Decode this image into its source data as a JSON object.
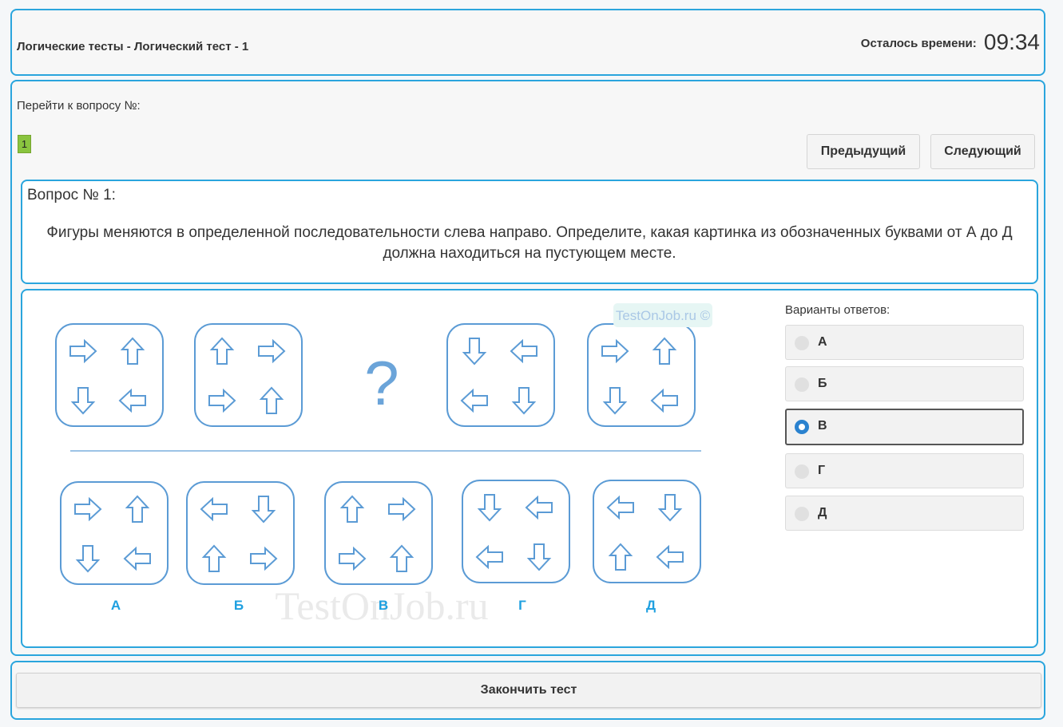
{
  "header": {
    "title": "Логические тесты - Логический тест - 1",
    "timer_label": "Осталось времени:",
    "timer_value": "09:34"
  },
  "navigation": {
    "goto_label": "Перейти к вопросу №:",
    "question_numbers": [
      "1"
    ],
    "prev_label": "Предыдущий",
    "next_label": "Следующий"
  },
  "question": {
    "heading": "Вопрос № 1:",
    "text": "Фигуры меняются в определенной последовательности слева направо. Определите, какая картинка из обозначенных буквами от А до Д должна находиться на пустующем месте."
  },
  "puzzle": {
    "question_mark": "?",
    "watermark_small": "TestOnJob.ru ©",
    "watermark_large": "TestOnJob.ru",
    "option_letters": [
      "А",
      "Б",
      "В",
      "Г",
      "Д"
    ],
    "top_sequence": [
      [
        "right",
        "up",
        "down",
        "left"
      ],
      [
        "up",
        "right",
        "right",
        "up"
      ],
      null,
      [
        "down",
        "left",
        "left",
        "down"
      ],
      [
        "right",
        "up",
        "down",
        "left"
      ]
    ],
    "choices": [
      [
        "right",
        "up",
        "down",
        "left"
      ],
      [
        "left",
        "down",
        "up",
        "right"
      ],
      [
        "up",
        "right",
        "right",
        "up"
      ],
      [
        "down",
        "left",
        "left",
        "down"
      ],
      [
        "left",
        "down",
        "up",
        "left"
      ]
    ]
  },
  "answers": {
    "label": "Варианты ответов:",
    "options": [
      "А",
      "Б",
      "В",
      "Г",
      "Д"
    ],
    "selected": "В"
  },
  "footer": {
    "finish_label": "Закончить тест"
  },
  "colors": {
    "border": "#2aa5dd",
    "figure": "#5b9bd5",
    "letter": "#1fa0e0",
    "qnum_bg": "#8ac43f",
    "radio_selected": "#2a82cf"
  }
}
